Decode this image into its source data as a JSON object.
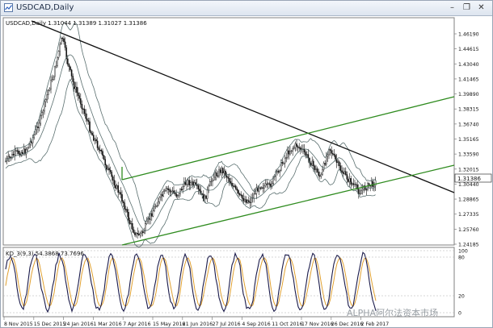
{
  "window": {
    "title": "USDCAD,Daily",
    "minimize_glyph": "–",
    "restore_glyph": "❐",
    "close_glyph": "✕"
  },
  "chart": {
    "info": "USDCAD,Daily  1.31044 1.31389 1.31027 1.31386",
    "current_price": "1.31386",
    "price_levels": [
      "1.46190",
      "1.44615",
      "1.43040",
      "1.41465",
      "1.39890",
      "1.38315",
      "1.36740",
      "1.35165",
      "1.33590",
      "1.32015",
      "1.30440",
      "1.28865",
      "1.27335",
      "1.25760",
      "1.24185"
    ],
    "oscillator_info": "KD_3(9,3) 54.3868 73.7696",
    "oscillator_levels": [
      "100",
      "80",
      "20",
      "0"
    ],
    "dates": [
      "8 Nov 2015",
      "15 Dec 2015",
      "24 Jan 2016",
      "1 Mar 2016",
      "7 Apr 2016",
      "15 May 2016",
      "21 Jun 2016",
      "27 Jul 2016",
      "4 Sep 2016",
      "11 Oct 2016",
      "17 Nov 2016",
      "26 Dec 2016",
      "2 Feb 2017"
    ],
    "watermark": "ALPHA阿尔法资本市场"
  },
  "colors": {
    "candle": "#111111",
    "bollinger": "#5a6f6f",
    "channel": "#2e8b1e",
    "trendline": "#111111",
    "stoch_k": "#1a1a4a",
    "stoch_d": "#e0a030",
    "price_tag_bg": "#ffffff"
  }
}
